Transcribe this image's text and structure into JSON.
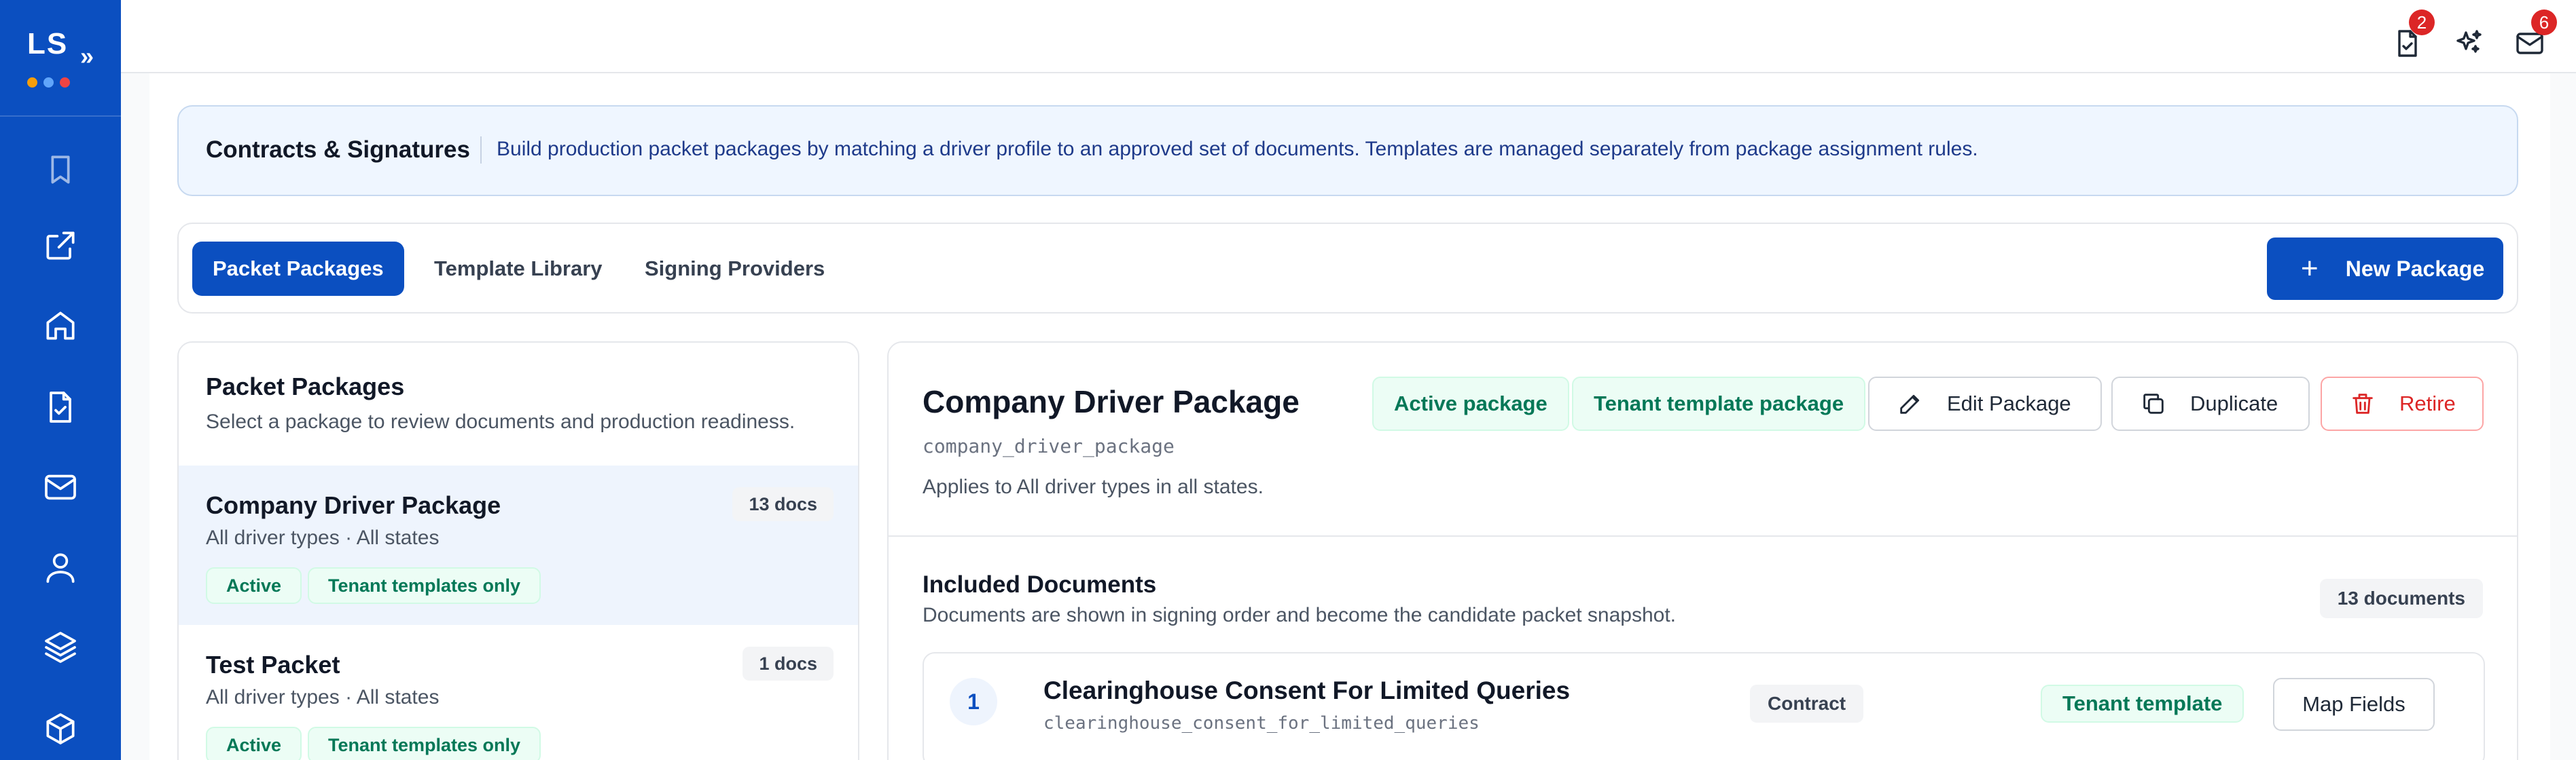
{
  "brand": {
    "text": "LS",
    "chevron": "»",
    "dots": [
      "#f59e0b",
      "#60a5fa",
      "#ef4444"
    ]
  },
  "sidebar": {
    "icons": [
      "bookmark-icon",
      "external-link-icon",
      "home-icon",
      "file-check-icon",
      "mail-icon",
      "user-icon",
      "layers-icon",
      "package-icon"
    ]
  },
  "topbar": {
    "icons": [
      {
        "name": "file-check-icon",
        "badge": "2"
      },
      {
        "name": "sparkles-icon",
        "badge": ""
      },
      {
        "name": "mail-icon",
        "badge": "6"
      }
    ]
  },
  "banner": {
    "title": "Contracts & Signatures",
    "description": "Build production packet packages by matching a driver profile to an approved set of documents. Templates are managed separately from package assignment rules."
  },
  "tabs": [
    {
      "label": "Packet Packages",
      "active": true
    },
    {
      "label": "Template Library",
      "active": false
    },
    {
      "label": "Signing Providers",
      "active": false
    }
  ],
  "new_package_label": "New Package",
  "left_panel": {
    "title": "Packet Packages",
    "subtitle": "Select a package to review documents and production readiness.",
    "packages": [
      {
        "name": "Company Driver Package",
        "meta": "All driver types · All states",
        "docs": "13 docs",
        "chips": [
          "Active",
          "Tenant templates only"
        ],
        "selected": true
      },
      {
        "name": "Test Packet",
        "meta": "All driver types · All states",
        "docs": "1 docs",
        "chips": [
          "Active",
          "Tenant templates only"
        ],
        "selected": false
      }
    ]
  },
  "detail": {
    "title": "Company Driver Package",
    "code": "company_driver_package",
    "applies": "Applies to All driver types in all states.",
    "status_chips": [
      "Active package",
      "Tenant template package"
    ],
    "actions": {
      "edit": "Edit Package",
      "duplicate": "Duplicate",
      "retire": "Retire"
    },
    "included_title": "Included Documents",
    "included_subtitle": "Documents are shown in signing order and become the candidate packet snapshot.",
    "included_count": "13 documents",
    "documents": [
      {
        "num": "1",
        "name": "Clearinghouse Consent For Limited Queries",
        "code": "clearinghouse_consent_for_limited_queries",
        "type": "Contract",
        "template": "Tenant template",
        "action": "Map Fields"
      }
    ]
  },
  "colors": {
    "primary": "#0b4fc0",
    "success": "#047857",
    "danger": "#dc2626"
  }
}
